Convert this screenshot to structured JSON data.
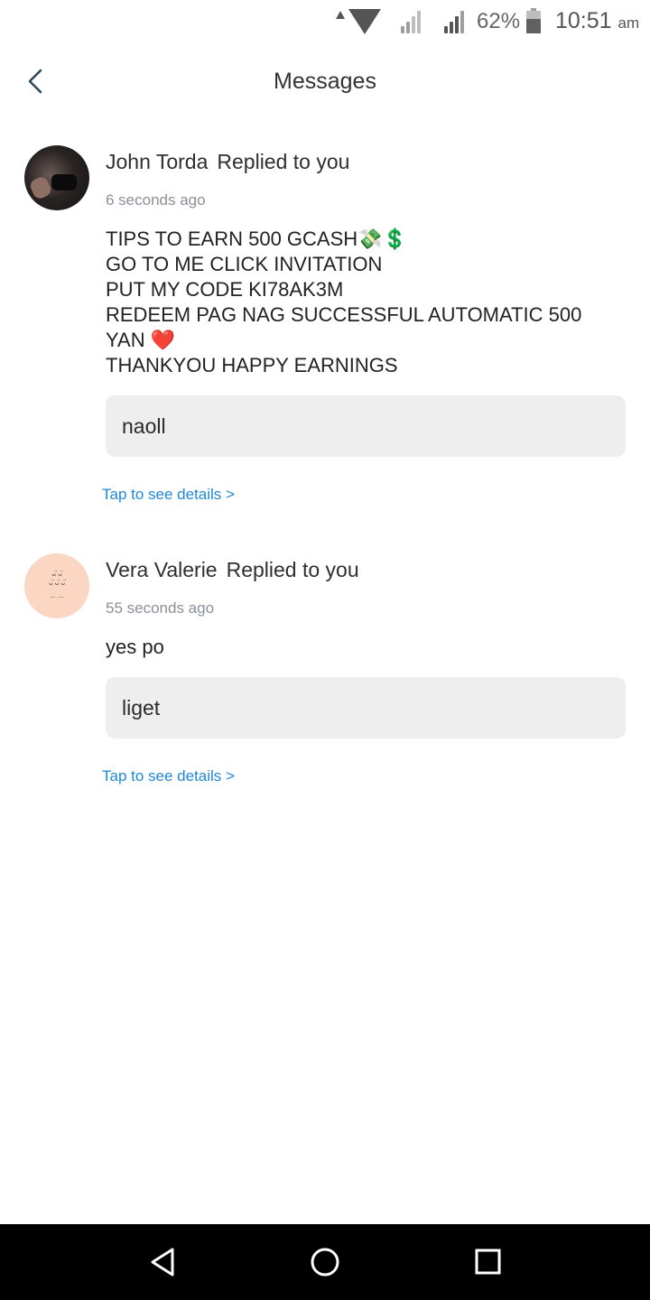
{
  "status_bar": {
    "battery_percent": "62%",
    "battery_level": 0.62,
    "time": "10:51",
    "ampm": "am",
    "icons": [
      "data-arrow-icon",
      "wifi-icon",
      "signal-icon",
      "signal-icon",
      "battery-icon"
    ]
  },
  "header": {
    "title": "Messages",
    "back_icon": "chevron-left-icon"
  },
  "notifications": [
    {
      "name": "John Torda",
      "action": "Replied to you",
      "time_ago": "6 seconds ago",
      "message_lines": [
        "TIPS TO EARN 500 GCASH💸💲",
        "GO TO ME CLICK INVITATION",
        "PUT MY CODE KI78AK3M",
        "REDEEM PAG NAG SUCCESSFUL AUTOMATIC 500",
        "YAN ❤️",
        "THANKYOU HAPPY EARNINGS"
      ],
      "quoted": "naoll",
      "details_link": "Tap to see details >"
    },
    {
      "name": "Vera Valerie",
      "action": "Replied to you",
      "time_ago": "55 seconds ago",
      "message_lines": [
        "yes po"
      ],
      "quoted": "liget",
      "details_link": "Tap to see details >"
    }
  ],
  "nav_bar": {
    "icons": [
      "back-triangle-icon",
      "home-circle-icon",
      "recents-square-icon"
    ]
  },
  "colors": {
    "link": "#1e88d6",
    "quote_bg": "#eeeeee",
    "timestamp": "#8a8f98",
    "back_chevron": "#2e4a5a"
  }
}
